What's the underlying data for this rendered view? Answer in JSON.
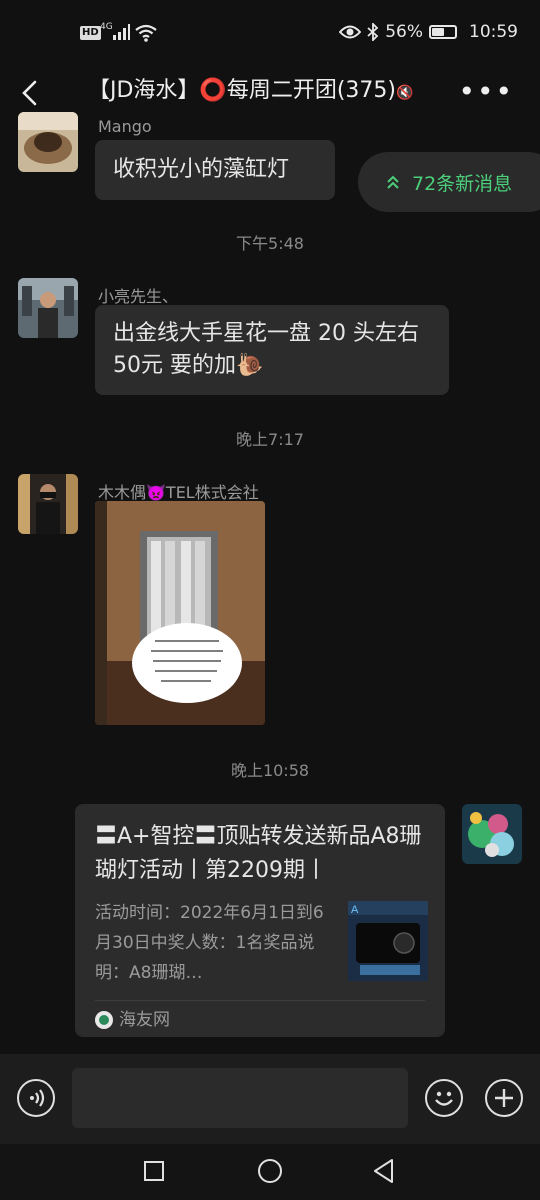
{
  "status_bar": {
    "hd": "HD",
    "network": "4G",
    "battery_percent": "56%",
    "battery_level": 0.56,
    "time": "10:59"
  },
  "header": {
    "title": "【JD海水】⭕每周二开团(375)",
    "title_suffix": "🔇"
  },
  "new_messages": "72条新消息",
  "messages": [
    {
      "sender": "Mango",
      "text": "收积光小的藻缸灯"
    },
    {
      "time": "下午5:48"
    },
    {
      "sender": "小亮先生、",
      "text": "出金线大手星花一盘 20 头左右 50元 要的加🐌"
    },
    {
      "time": "晚上7:17"
    },
    {
      "sender": "木木偶👿TEL株式会社",
      "type": "image"
    },
    {
      "time": "晚上10:58"
    },
    {
      "type": "link_card",
      "title": "〓A+智控〓顶贴转发送新品A8珊 瑚灯活动丨第2209期丨",
      "desc": "活动时间：2022年6月1日到6月30日中奖人数：1名奖品说明：A8珊瑚…",
      "source": "海友网"
    }
  ],
  "icons": {
    "back": "back-arrow-icon",
    "more": "more-dots-icon",
    "voice": "voice-icon",
    "emoji": "emoji-icon",
    "add": "add-icon",
    "nav_recent": "square-icon",
    "nav_home": "circle-icon",
    "nav_back": "triangle-icon"
  },
  "colors": {
    "background": "#111111",
    "bubble": "#2c2c2c",
    "accent_green": "#4ccf7b"
  }
}
